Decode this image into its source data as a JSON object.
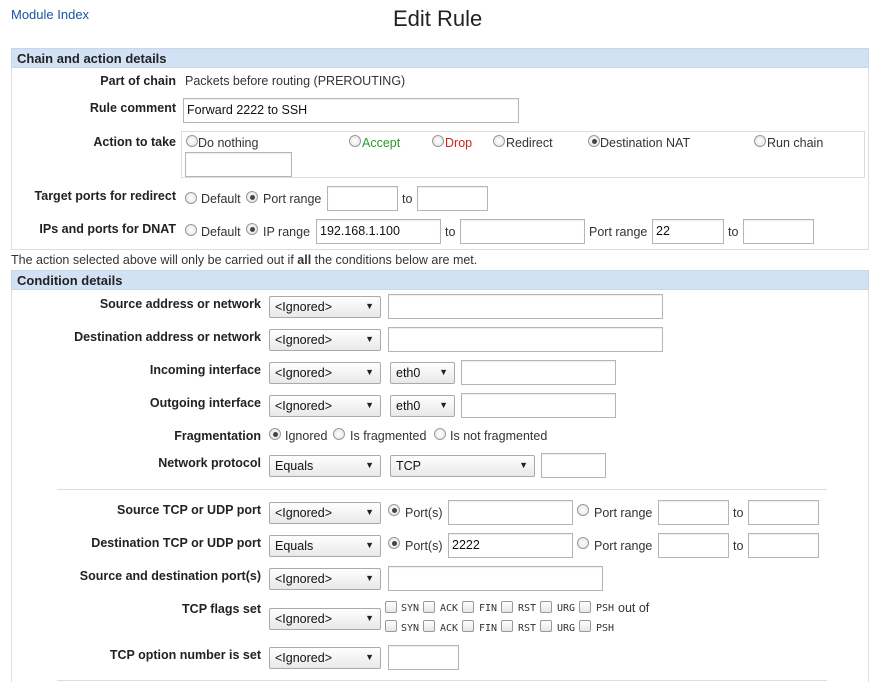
{
  "header": {
    "module_index": "Module Index",
    "title": "Edit Rule"
  },
  "chain_section": {
    "title": "Chain and action details",
    "part_of_chain": {
      "label": "Part of chain",
      "value": "Packets before routing (PREROUTING)"
    },
    "rule_comment": {
      "label": "Rule comment",
      "value": "Forward 2222 to SSH"
    },
    "action": {
      "label": "Action to take",
      "options": [
        "Do nothing",
        "Accept",
        "Drop",
        "Redirect",
        "Destination NAT",
        "Run chain"
      ],
      "selected": "Destination NAT",
      "run_chain_value": ""
    },
    "target_ports": {
      "label": "Target ports for redirect",
      "default": "Default",
      "range": "Port range",
      "to": "to",
      "from_value": "",
      "to_value": ""
    },
    "dnat": {
      "label": "IPs and ports for DNAT",
      "default": "Default",
      "ip_range": "IP range",
      "ip_from": "192.168.1.100",
      "to": "to",
      "ip_to": "",
      "port_range": "Port range",
      "port_from": "22",
      "port_to": ""
    }
  },
  "note": {
    "before": "The action selected above will only be carried out if ",
    "bold": "all",
    "after": " the conditions below are met."
  },
  "condition_section": {
    "title": "Condition details",
    "source_addr": {
      "label": "Source address or network",
      "select": "<Ignored>",
      "value": ""
    },
    "dest_addr": {
      "label": "Destination address or network",
      "select": "<Ignored>",
      "value": ""
    },
    "in_iface": {
      "label": "Incoming interface",
      "select": "<Ignored>",
      "iface": "eth0",
      "value": ""
    },
    "out_iface": {
      "label": "Outgoing interface",
      "select": "<Ignored>",
      "iface": "eth0",
      "value": ""
    },
    "fragmentation": {
      "label": "Fragmentation",
      "options": [
        "Ignored",
        "Is fragmented",
        "Is not fragmented"
      ],
      "selected": "Ignored"
    },
    "protocol": {
      "label": "Network protocol",
      "select": "Equals",
      "proto": "TCP",
      "value": ""
    },
    "src_port": {
      "label": "Source TCP or UDP port",
      "select": "<Ignored>",
      "ports_label": "Port(s)",
      "ports_value": "",
      "range_label": "Port range",
      "to": "to",
      "range_from": "",
      "range_to": ""
    },
    "dst_port": {
      "label": "Destination TCP or UDP port",
      "select": "Equals",
      "ports_label": "Port(s)",
      "ports_value": "2222",
      "range_label": "Port range",
      "to": "to",
      "range_from": "",
      "range_to": ""
    },
    "src_dst_port": {
      "label": "Source and destination port(s)",
      "select": "<Ignored>",
      "value": ""
    },
    "tcp_flags": {
      "label": "TCP flags set",
      "select": "<Ignored>",
      "flags": [
        "SYN",
        "ACK",
        "FIN",
        "RST",
        "URG",
        "PSH"
      ],
      "out_of": "out of"
    },
    "tcp_option": {
      "label": "TCP option number is set",
      "select": "<Ignored>",
      "value": ""
    }
  },
  "colors": {
    "header_bg": "#d3e1f5",
    "link": "#1a55a5",
    "accept": "#2a9a2a",
    "drop": "#d42020"
  }
}
